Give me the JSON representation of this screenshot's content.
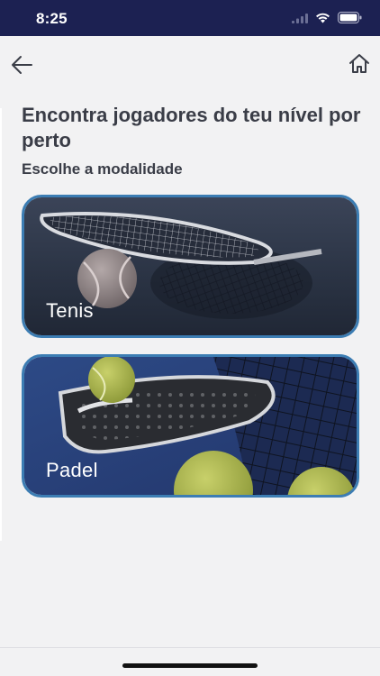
{
  "status_bar": {
    "time": "8:25",
    "icons": [
      "signal-icon",
      "wifi-icon",
      "battery-icon"
    ]
  },
  "nav": {
    "back_icon": "arrow-left-icon",
    "home_icon": "home-icon"
  },
  "content": {
    "headline": "Encontra jogadores do teu nível por perto",
    "subheadline": "Escolhe a modalidade"
  },
  "sports": [
    {
      "label": "Tenis"
    },
    {
      "label": "Padel"
    }
  ],
  "colors": {
    "status_bar": "#1c2152",
    "card_border": "#3c7db3",
    "background": "#f2f2f3",
    "text": "#3a3d47"
  }
}
